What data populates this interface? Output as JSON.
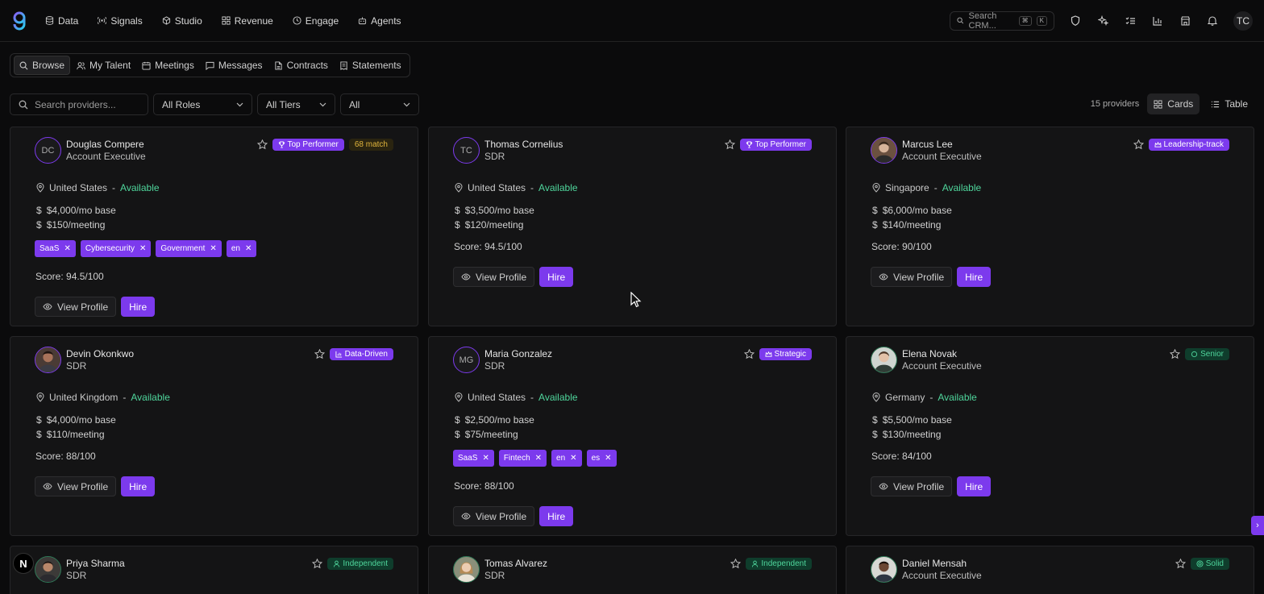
{
  "nav": {
    "items": [
      {
        "label": "Data",
        "icon": "database-icon"
      },
      {
        "label": "Signals",
        "icon": "signal-icon"
      },
      {
        "label": "Studio",
        "icon": "cube-icon"
      },
      {
        "label": "Revenue",
        "icon": "grid-icon"
      },
      {
        "label": "Engage",
        "icon": "engage-icon"
      },
      {
        "label": "Agents",
        "icon": "robot-icon"
      }
    ],
    "search_placeholder": "Search CRM...",
    "kbd1": "⌘",
    "kbd2": "K",
    "user_initials": "TC"
  },
  "subnav": {
    "tabs": [
      {
        "label": "Browse",
        "active": true
      },
      {
        "label": "My Talent"
      },
      {
        "label": "Meetings"
      },
      {
        "label": "Messages"
      },
      {
        "label": "Contracts"
      },
      {
        "label": "Statements"
      }
    ]
  },
  "filters": {
    "search_placeholder": "Search providers...",
    "roles": "All Roles",
    "tiers": "All Tiers",
    "all": "All"
  },
  "view": {
    "count": "15 providers",
    "cards_label": "Cards",
    "table_label": "Table"
  },
  "common": {
    "view_profile": "View Profile",
    "hire": "Hire",
    "sep": "-"
  },
  "cards": [
    {
      "initials": "DC",
      "name": "Douglas Compere",
      "role": "Account Executive",
      "badge": "Top Performer",
      "badge_style": "purple",
      "match": "68 match",
      "location": "United States",
      "status": "Available",
      "base": "$4,000/mo base",
      "meeting": "$150/meeting",
      "tags": [
        "SaaS",
        "Cybersecurity",
        "Government",
        "en"
      ],
      "score": "Score: 94.5/100"
    },
    {
      "initials": "TC",
      "name": "Thomas Cornelius",
      "role": "SDR",
      "badge": "Top Performer",
      "badge_style": "purple",
      "location": "United States",
      "status": "Available",
      "base": "$3,500/mo base",
      "meeting": "$120/meeting",
      "tags": [],
      "score": "Score: 94.5/100"
    },
    {
      "initials": "",
      "name": "Marcus Lee",
      "role": "Account Executive",
      "badge": "Leadership-track",
      "badge_style": "purple",
      "location": "Singapore",
      "status": "Available",
      "base": "$6,000/mo base",
      "meeting": "$140/meeting",
      "tags": [],
      "score": "Score: 90/100"
    },
    {
      "initials": "",
      "name": "Devin Okonkwo",
      "role": "SDR",
      "badge": "Data-Driven",
      "badge_style": "purple",
      "location": "United Kingdom",
      "status": "Available",
      "base": "$4,000/mo base",
      "meeting": "$110/meeting",
      "tags": [],
      "score": "Score: 88/100"
    },
    {
      "initials": "MG",
      "name": "Maria Gonzalez",
      "role": "SDR",
      "badge": "Strategic",
      "badge_style": "purple",
      "location": "United States",
      "status": "Available",
      "base": "$2,500/mo base",
      "meeting": "$75/meeting",
      "tags": [
        "SaaS",
        "Fintech",
        "en",
        "es"
      ],
      "score": "Score: 88/100"
    },
    {
      "initials": "",
      "name": "Elena Novak",
      "role": "Account Executive",
      "badge": "Senior",
      "badge_style": "green",
      "location": "Germany",
      "status": "Available",
      "base": "$5,500/mo base",
      "meeting": "$130/meeting",
      "tags": [],
      "score": "Score: 84/100"
    },
    {
      "initials": "",
      "name": "Priya Sharma",
      "role": "SDR",
      "badge": "Independent",
      "badge_style": "green"
    },
    {
      "initials": "",
      "name": "Tomas Alvarez",
      "role": "SDR",
      "badge": "Independent",
      "badge_style": "green"
    },
    {
      "initials": "",
      "name": "Daniel Mensah",
      "role": "Account Executive",
      "badge": "Solid",
      "badge_style": "green"
    }
  ],
  "colors": {
    "accent": "#7c3aed",
    "available": "#4fd69c",
    "background": "#0b0b0c"
  },
  "floating": {
    "n_label": "N",
    "side_arrow": "›"
  }
}
